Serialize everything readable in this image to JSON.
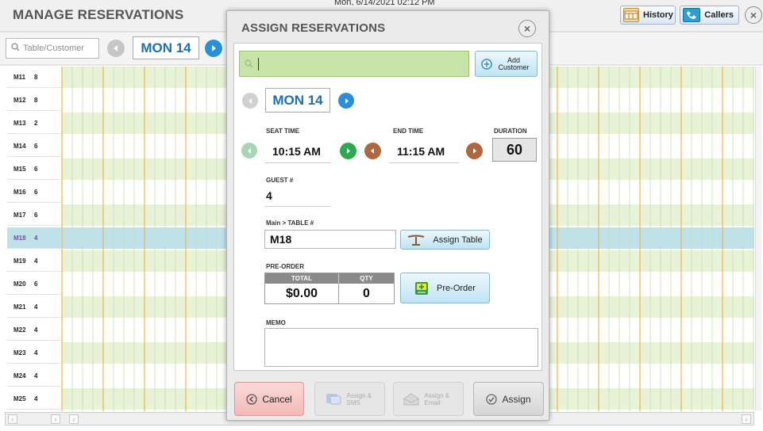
{
  "header": {
    "title": "MANAGE RESERVATIONS",
    "date_text": "Mon, 6/14/2021 02:12 PM",
    "history_label": "History",
    "callers_label": "Callers"
  },
  "toolbar": {
    "search_placeholder": "Table/Customer",
    "date_label": "MON 14"
  },
  "tables": [
    {
      "name": "M11",
      "cap": "8"
    },
    {
      "name": "M12",
      "cap": "8"
    },
    {
      "name": "M13",
      "cap": "2"
    },
    {
      "name": "M14",
      "cap": "6"
    },
    {
      "name": "M15",
      "cap": "6"
    },
    {
      "name": "M16",
      "cap": "6"
    },
    {
      "name": "M17",
      "cap": "6"
    },
    {
      "name": "M18",
      "cap": "4",
      "selected": true
    },
    {
      "name": "M19",
      "cap": "4"
    },
    {
      "name": "M20",
      "cap": "6"
    },
    {
      "name": "M21",
      "cap": "4"
    },
    {
      "name": "M22",
      "cap": "4"
    },
    {
      "name": "M23",
      "cap": "4"
    },
    {
      "name": "M24",
      "cap": "4"
    },
    {
      "name": "M25",
      "cap": "4"
    }
  ],
  "modal": {
    "title": "ASSIGN RESERVATIONS",
    "search_value": "",
    "add_customer_label": "Add Customer",
    "date_label": "MON 14",
    "seat_time_label": "SEAT TIME",
    "seat_time": "10:15 AM",
    "end_time_label": "END TIME",
    "end_time": "11:15 AM",
    "duration_label": "DURATION",
    "duration": "60",
    "guest_label": "GUEST #",
    "guest_count": "4",
    "table_label": "Main > TABLE #",
    "table_value": "M18",
    "assign_table_label": "Assign Table",
    "preorder_label": "PRE-ORDER",
    "total_header": "TOTAL",
    "qty_header": "QTY",
    "total_value": "$0.00",
    "qty_value": "0",
    "preorder_button": "Pre-Order",
    "memo_label": "MEMO",
    "memo_value": "",
    "cancel_label": "Cancel",
    "assign_sms_label": "Assign & SMS",
    "assign_email_label": "Assign & Email",
    "assign_label": "Assign"
  },
  "colors": {
    "grid_green": "#e7f2d7",
    "selected_row": "#bfe2ea",
    "accent_blue": "#2a8fd8",
    "green_arrow": "#2fa84f",
    "brown_arrow": "#b0663f",
    "cancel_pink": "#f6c9c9"
  }
}
